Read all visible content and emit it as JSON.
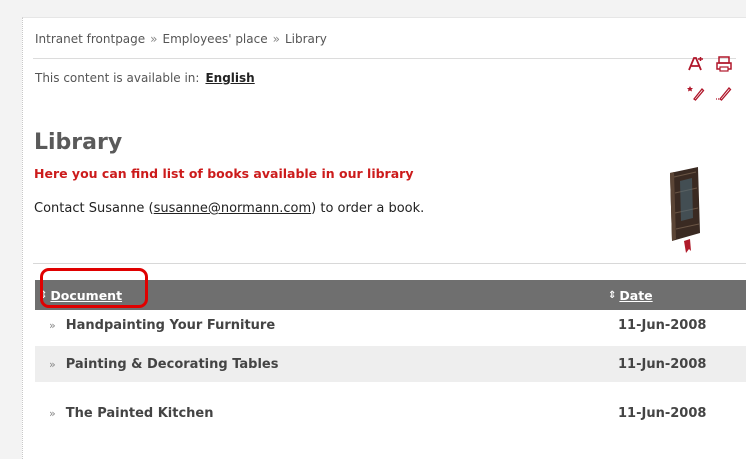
{
  "breadcrumb": {
    "items": [
      "Intranet frontpage",
      "Employees' place",
      "Library"
    ],
    "separator": "»"
  },
  "language": {
    "prefix": "This content is available in:",
    "current": "English"
  },
  "toolbar": {
    "icons": [
      "translate-icon",
      "print-icon",
      "new-content-icon",
      "edit-icon"
    ]
  },
  "page": {
    "title": "Library",
    "lead": "Here you can find list of books available in our library",
    "contact_before": "Contact Susanne (",
    "contact_email": "susanne@normann.com",
    "contact_after": ") to order a book."
  },
  "table": {
    "headers": {
      "document": "Document",
      "date": "Date"
    },
    "rows": [
      {
        "document": "Handpainting Your Furniture",
        "date": "11-Jun-2008"
      },
      {
        "document": "Painting & Decorating Tables",
        "date": "11-Jun-2008"
      },
      {
        "document": "The Painted Kitchen",
        "date": "11-Jun-2008"
      }
    ]
  },
  "colors": {
    "accent_red": "#cc1b1b",
    "header_gray": "#6f6f6f",
    "highlight": "#e00000"
  }
}
